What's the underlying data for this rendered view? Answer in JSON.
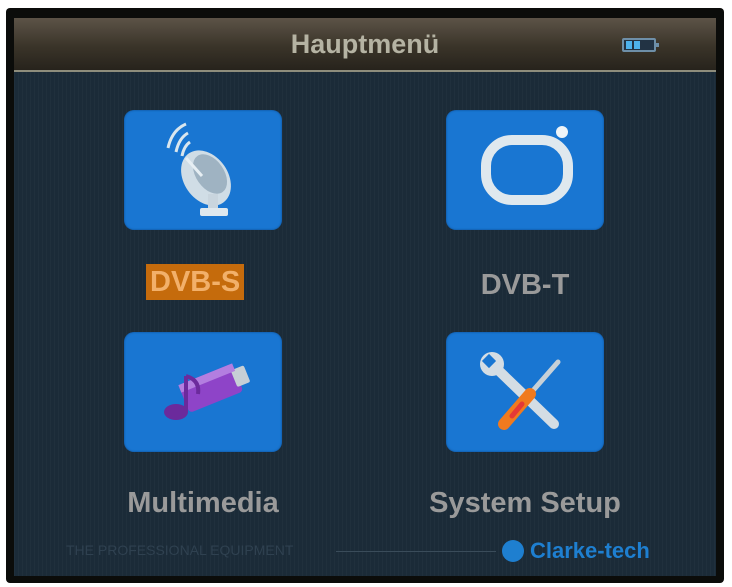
{
  "header": {
    "title": "Hauptmenü",
    "battery_icon": "battery-icon"
  },
  "menu": {
    "items": [
      {
        "label": "DVB-S",
        "icon": "satellite-dish-icon",
        "selected": true
      },
      {
        "label": "DVB-T",
        "icon": "tv-icon",
        "selected": false
      },
      {
        "label": "Multimedia",
        "icon": "music-icon",
        "selected": false
      },
      {
        "label": "System Setup",
        "icon": "tools-icon",
        "selected": false
      }
    ]
  },
  "footer": {
    "tagline": "THE PROFESSIONAL EQUIPMENT",
    "brand": "Clarke-tech"
  },
  "colors": {
    "tile": "#1976d2",
    "selection": "#c56b0c",
    "background": "#1b2b38"
  }
}
